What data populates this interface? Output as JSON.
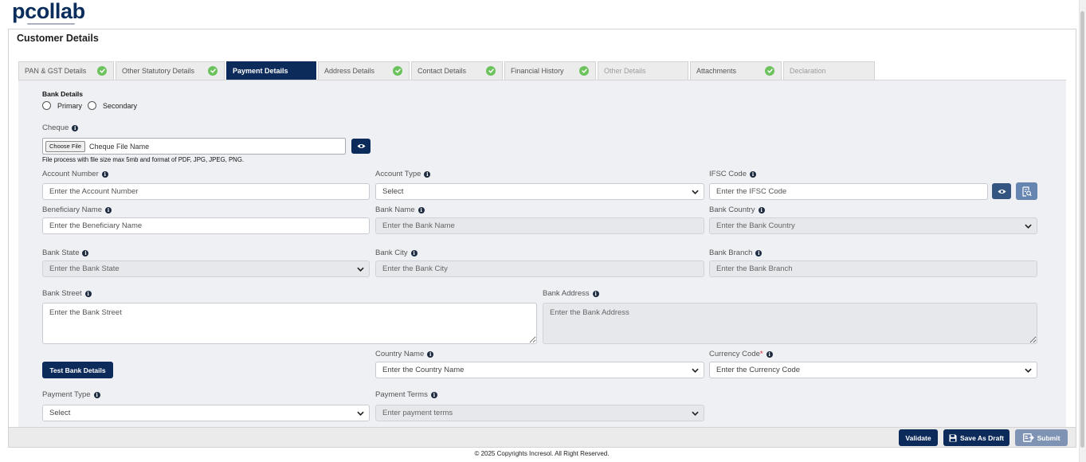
{
  "logo": {
    "text": "pcollab"
  },
  "page_title": "Customer Details",
  "tabs": [
    {
      "label": "PAN & GST Details",
      "completed": true,
      "active": false
    },
    {
      "label": "Other Statutory Details",
      "completed": true,
      "active": false
    },
    {
      "label": "Payment Details",
      "completed": false,
      "active": true
    },
    {
      "label": "Address Details",
      "completed": true,
      "active": false
    },
    {
      "label": "Contact Details",
      "completed": true,
      "active": false
    },
    {
      "label": "Financial History",
      "completed": true,
      "active": false
    },
    {
      "label": "Other Details",
      "completed": false,
      "active": false
    },
    {
      "label": "Attachments",
      "completed": true,
      "active": false
    },
    {
      "label": "Declaration",
      "completed": false,
      "active": false
    }
  ],
  "bank_details": {
    "title": "Bank Details",
    "radios": [
      {
        "label": "Primary",
        "checked": false
      },
      {
        "label": "Secondary",
        "checked": false
      }
    ]
  },
  "cheque": {
    "label": "Cheque",
    "choose_file": "Choose File",
    "file_name": "Cheque File Name",
    "hint": "File process with file size max 5mb and format of PDF, JPG, JPEG, PNG."
  },
  "fields": {
    "account_number": {
      "label": "Account Number",
      "placeholder": "Enter the Account Number",
      "disabled": false
    },
    "account_type": {
      "label": "Account Type",
      "value": "Select",
      "disabled": false
    },
    "ifsc_code": {
      "label": "IFSC Code",
      "placeholder": "Enter the IFSC Code",
      "disabled": false
    },
    "beneficiary_name": {
      "label": "Beneficiary Name",
      "placeholder": "Enter the Beneficiary Name",
      "disabled": false
    },
    "bank_name": {
      "label": "Bank Name",
      "placeholder": "Enter the Bank Name",
      "disabled": true
    },
    "bank_country": {
      "label": "Bank Country",
      "value": "Enter the Bank Country",
      "disabled": true
    },
    "bank_state": {
      "label": "Bank State",
      "value": "Enter the Bank State",
      "disabled": true
    },
    "bank_city": {
      "label": "Bank City",
      "placeholder": "Enter the Bank City",
      "disabled": true
    },
    "bank_branch": {
      "label": "Bank Branch",
      "placeholder": "Enter the Bank Branch",
      "disabled": true
    },
    "bank_street": {
      "label": "Bank Street",
      "placeholder": "Enter the Bank Street",
      "disabled": false
    },
    "bank_address": {
      "label": "Bank Address",
      "placeholder": "Enter the Bank Address",
      "disabled": true
    },
    "country_name": {
      "label": "Country Name",
      "value": "Enter the Country Name",
      "disabled": false
    },
    "currency_code": {
      "label": "Currency Code",
      "required_mark": "*",
      "value": "Enter the Currency Code",
      "disabled": false
    },
    "payment_type": {
      "label": "Payment Type",
      "value": "Select",
      "disabled": false
    },
    "payment_terms": {
      "label": "Payment Terms",
      "value": "Enter payment terms",
      "disabled": true
    }
  },
  "buttons": {
    "test_bank_details": "Test Bank Details",
    "validate": "Validate",
    "save_as_draft": "Save As Draft",
    "submit": "Submit"
  },
  "footer": "© 2025 Copyrights Incresol. All Right Reserved.",
  "colors": {
    "primary": "#0c2b5b",
    "tab_complete": "#6cc25c",
    "required": "#e0262b",
    "panel_background": "#eef0f3",
    "disabled_field": "#e6e8eb",
    "submit_button": "#7f93b4"
  },
  "icons": {
    "info": "info-icon",
    "tab_complete": "check-circle-icon",
    "view": "eye-icon",
    "bank_lookup": "document-search-icon",
    "dropdown": "chevron-down-icon",
    "save": "floppy-disk-icon",
    "submit": "submit-card-icon"
  }
}
